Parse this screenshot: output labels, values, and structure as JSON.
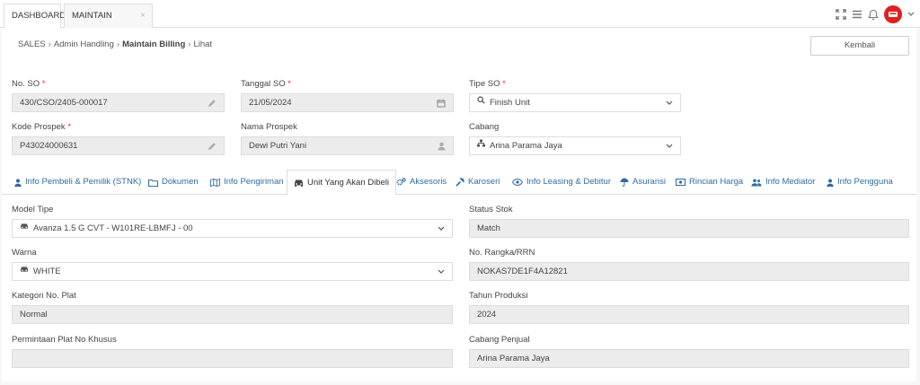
{
  "topbar": {
    "tabs": [
      {
        "label": "DASHBOARD"
      },
      {
        "label": "MAINTAIN BILLING",
        "close": "×"
      }
    ]
  },
  "breadcrumb": {
    "items": [
      "SALES",
      "Admin Handling",
      "Maintain Billing",
      "Lihat"
    ]
  },
  "buttons": {
    "back": "Kembali"
  },
  "form": {
    "no_so": {
      "label": "No. SO",
      "value": "430/CSO/2405-000017"
    },
    "tanggal_so": {
      "label": "Tanggal SO",
      "value": "21/05/2024"
    },
    "tipe_so": {
      "label": "Tipe SO",
      "value": "Finish Unit"
    },
    "kode_prospek": {
      "label": "Kode Prospek",
      "value": "P43024000631"
    },
    "nama_prospek": {
      "label": "Nama Prospek",
      "value": "Dewi Putri Yani"
    },
    "cabang": {
      "label": "Cabang",
      "value": "Arina Parama Jaya"
    },
    "required_mark": "*"
  },
  "tabs": [
    {
      "label": "Info Pembeli & Pemilik (STNK)",
      "icon": "user-icon"
    },
    {
      "label": "Dokumen",
      "icon": "folder-icon"
    },
    {
      "label": "Info Pengiriman",
      "icon": "map-icon"
    },
    {
      "label": "Unit Yang Akan Dibeli",
      "icon": "car-icon"
    },
    {
      "label": "Aksesoris",
      "icon": "cogs-icon"
    },
    {
      "label": "Karoseri",
      "icon": "wrench-icon"
    },
    {
      "label": "Info Leasing & Debitur",
      "icon": "eye-icon"
    },
    {
      "label": "Asuransi",
      "icon": "umbrella-icon"
    },
    {
      "label": "Rincian Harga",
      "icon": "money-icon"
    },
    {
      "label": "Info Mediator",
      "icon": "users-icon"
    },
    {
      "label": "Info Pengguna",
      "icon": "user-icon"
    }
  ],
  "unit": {
    "model_tipe": {
      "label": "Model Tipe",
      "value": "Avanza 1.5 G CVT - W101RE-LBMFJ - 00"
    },
    "status_stok": {
      "label": "Status Stok",
      "value": "Match"
    },
    "warna": {
      "label": "Warna",
      "value": "WHITE"
    },
    "no_rangka": {
      "label": "No. Rangka/RRN",
      "value": "NOKAS7DE1F4A12821"
    },
    "kategori_plat": {
      "label": "Kategori No. Plat",
      "value": "Normal"
    },
    "tahun_produksi": {
      "label": "Tahun Produksi",
      "value": "2024"
    },
    "permintaan_plat": {
      "label": "Permintaan Plat No Khusus",
      "value": ""
    },
    "cabang_penjual": {
      "label": "Cabang Penjual",
      "value": "Arina Parama Jaya"
    }
  },
  "colors": {
    "link": "#2d6ca2",
    "required": "#d33333",
    "avatar": "#e02020"
  }
}
